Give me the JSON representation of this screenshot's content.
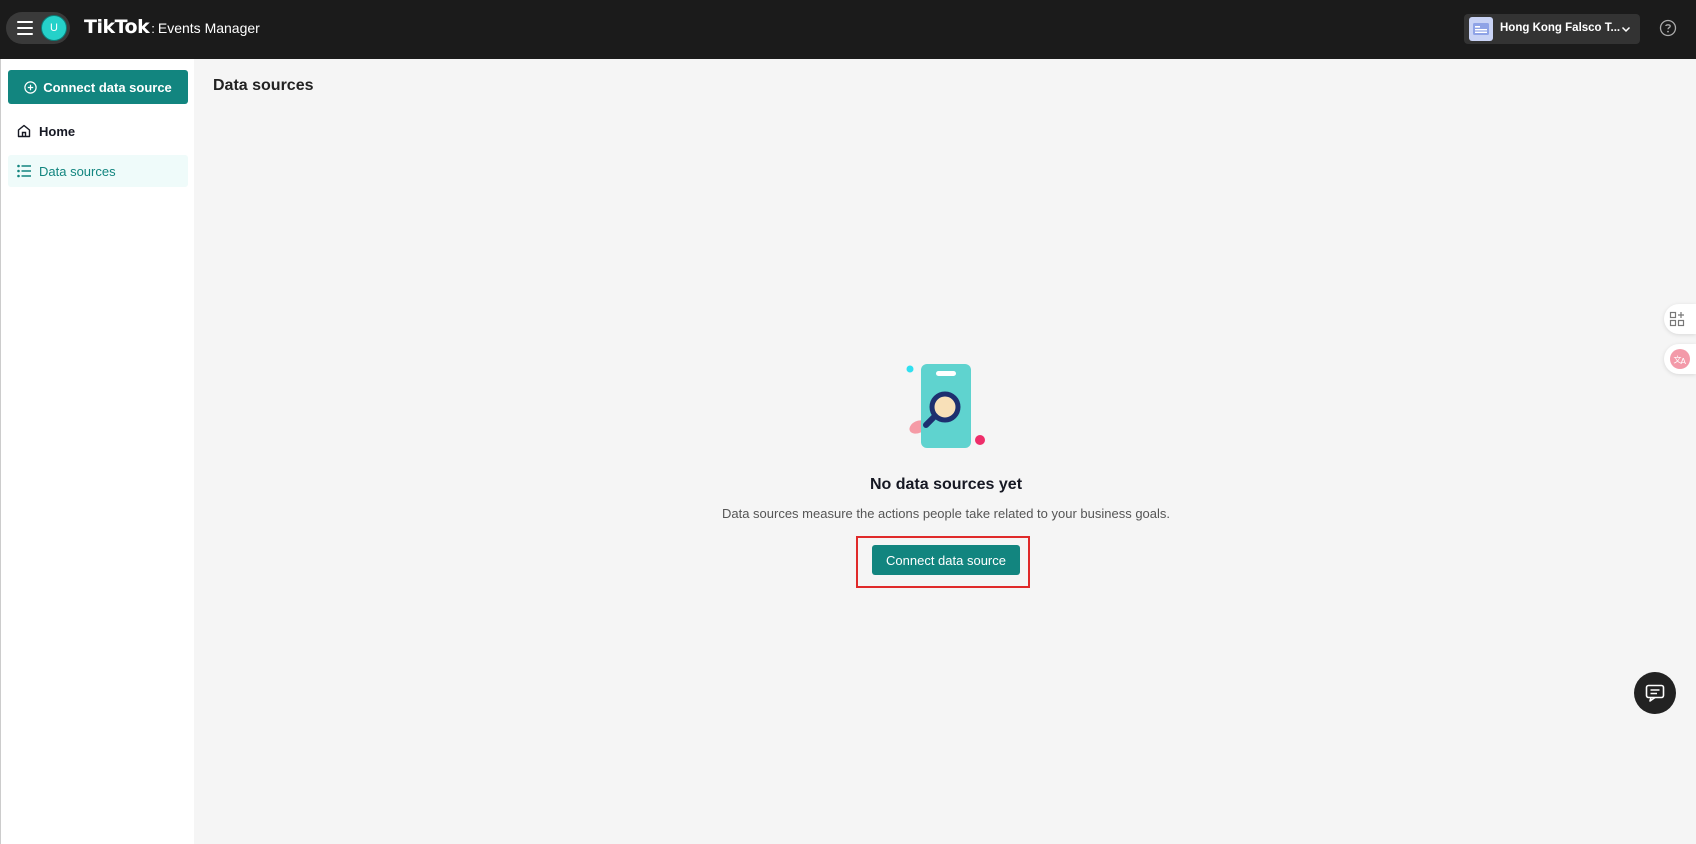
{
  "header": {
    "avatar_initial": "U",
    "brand_name": "TikTok",
    "brand_separator": ":",
    "product_name": "Events Manager",
    "account_name": "Hong Kong Falsco T..."
  },
  "sidebar": {
    "connect_button_label": "Connect data source",
    "items": [
      {
        "label": "Home",
        "icon": "home-icon",
        "active": false
      },
      {
        "label": "Data sources",
        "icon": "list-icon",
        "active": true
      }
    ]
  },
  "main": {
    "page_title": "Data sources",
    "empty_state": {
      "title": "No data sources yet",
      "description": "Data sources measure the actions people take related to your business goals.",
      "button_label": "Connect data source"
    }
  },
  "colors": {
    "topbar": "#1b1b1b",
    "primary": "#12857f",
    "active_nav_bg": "#effbfa",
    "highlight": "#e02a2a"
  }
}
